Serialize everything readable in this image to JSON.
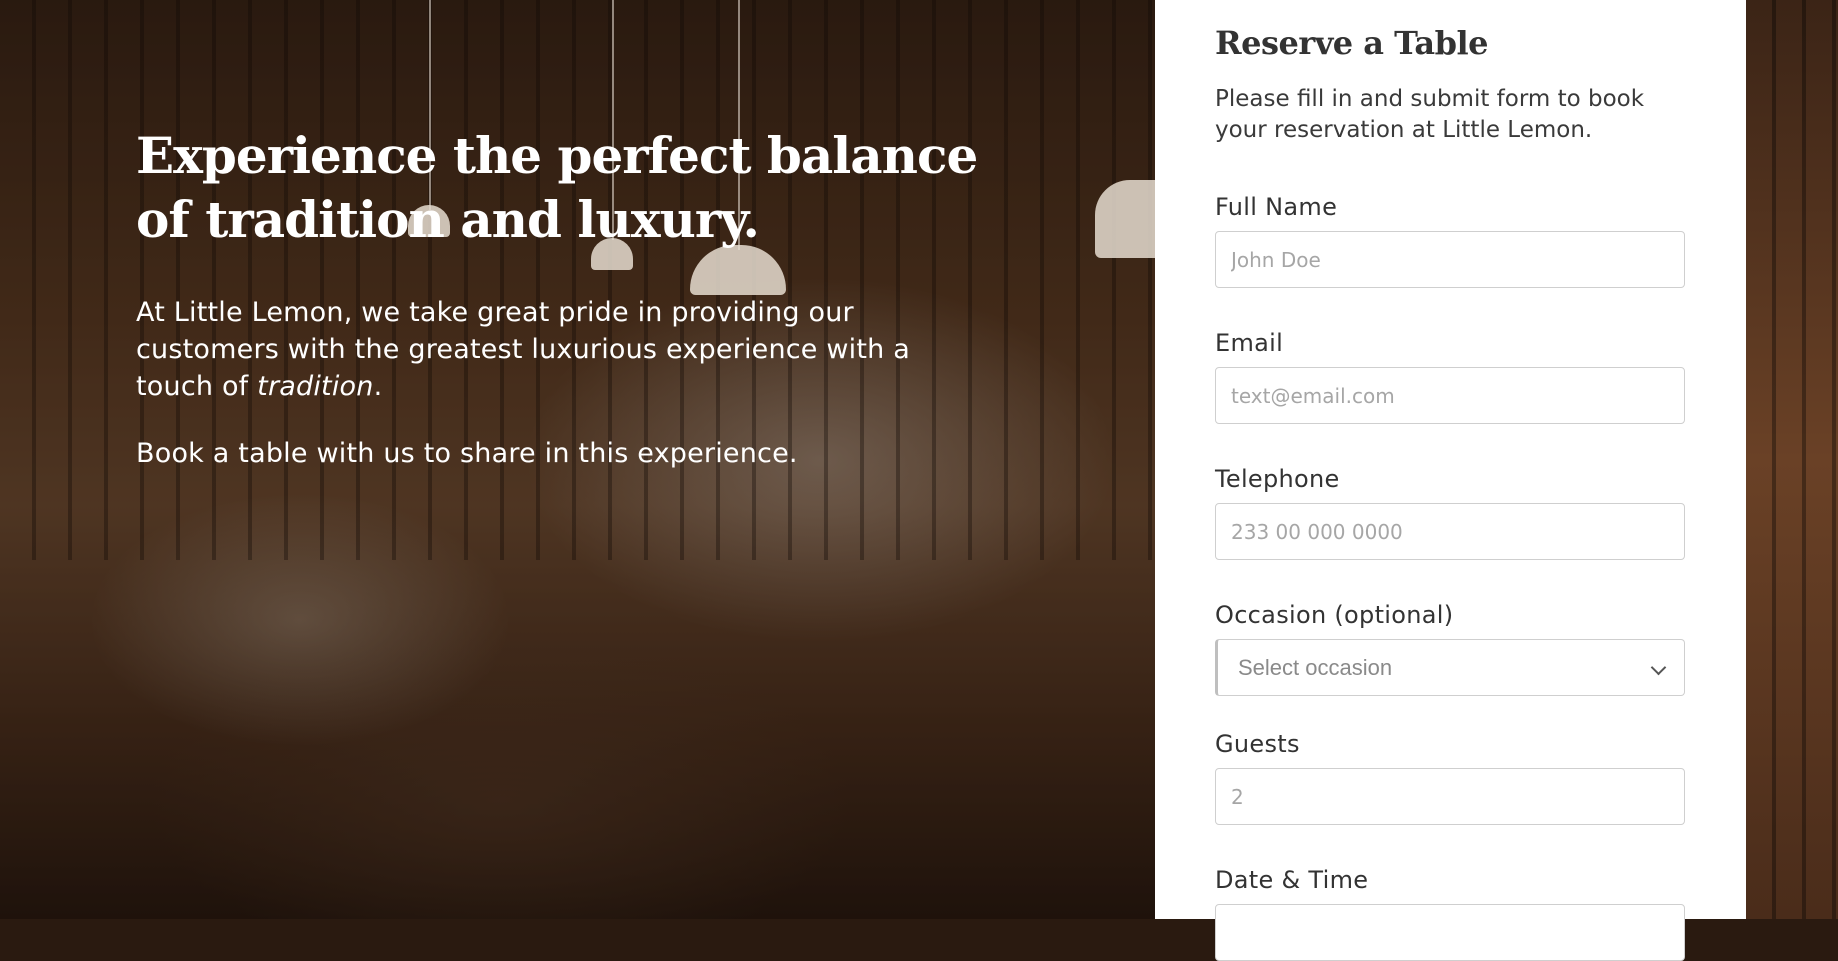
{
  "hero": {
    "headline": "Experience the perfect balance of tradition and luxury.",
    "paragraph_before_em": "At Little Lemon, we take great pride in providing our customers with the greatest luxurious experience with a touch of ",
    "paragraph_em": "tradition",
    "paragraph_after_em": ".",
    "paragraph2": "Book a table with us to share in this experience."
  },
  "form": {
    "title": "Reserve a Table",
    "description": "Please fill in and submit form to book your reservation at Little Lemon.",
    "full_name": {
      "label": "Full Name",
      "placeholder": "John Doe"
    },
    "email": {
      "label": "Email",
      "placeholder": "text@email.com"
    },
    "telephone": {
      "label": "Telephone",
      "placeholder": "233 00 000 0000"
    },
    "occasion": {
      "label": "Occasion (optional)",
      "selected": "Select occasion"
    },
    "guests": {
      "label": "Guests",
      "placeholder": "2"
    },
    "datetime": {
      "label": "Date & Time"
    }
  },
  "icons": {
    "occasion_dropdown": "chevron-down-icon"
  }
}
